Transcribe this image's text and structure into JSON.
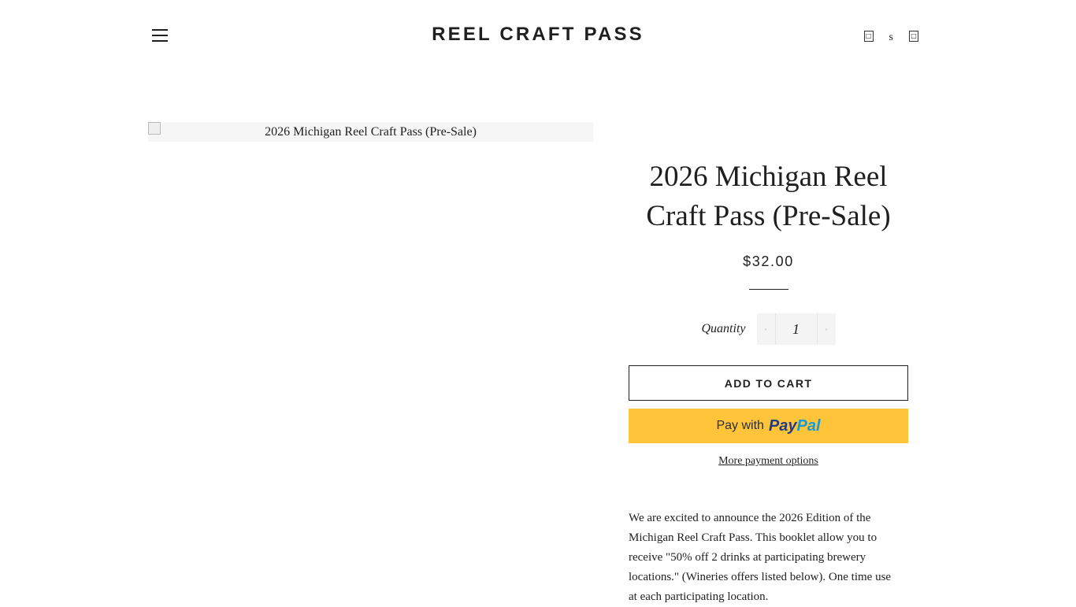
{
  "header": {
    "title": "REEL CRAFT PASS",
    "right_icons": [
      {
        "icon": "user-icon",
        "glyph": "□"
      },
      {
        "icon": "search-icon",
        "glyph": "s"
      },
      {
        "icon": "cart-icon",
        "glyph": "□"
      }
    ]
  },
  "product": {
    "image_alt": "2026 Michigan Reel Craft Pass (Pre-Sale)",
    "title": "2026 Michigan Reel Craft Pass (Pre-Sale)",
    "price": "$32.00",
    "quantity_label": "Quantity",
    "quantity_value": "1",
    "qty_minus": "▫",
    "qty_plus": "▫",
    "add_to_cart_label": "ADD TO CART",
    "paypal": {
      "pay_with": "Pay with",
      "brand_part1": "Pay",
      "brand_part2": "Pal"
    },
    "more_payment_options": "More payment options",
    "description": " We are excited to announce the 2026 Edition of the Michigan Reel Craft Pass. This booklet allow you to receive \"50% off 2 drinks at participating brewery locations.\" (Wineries offers listed below). One time use at each participating location."
  },
  "colors": {
    "text": "#1f1f1f",
    "paypal_yellow": "#ffc439",
    "paypal_dark_blue": "#253b80",
    "paypal_light_blue": "#179bd7",
    "qty_bg": "#f4f4f4"
  }
}
